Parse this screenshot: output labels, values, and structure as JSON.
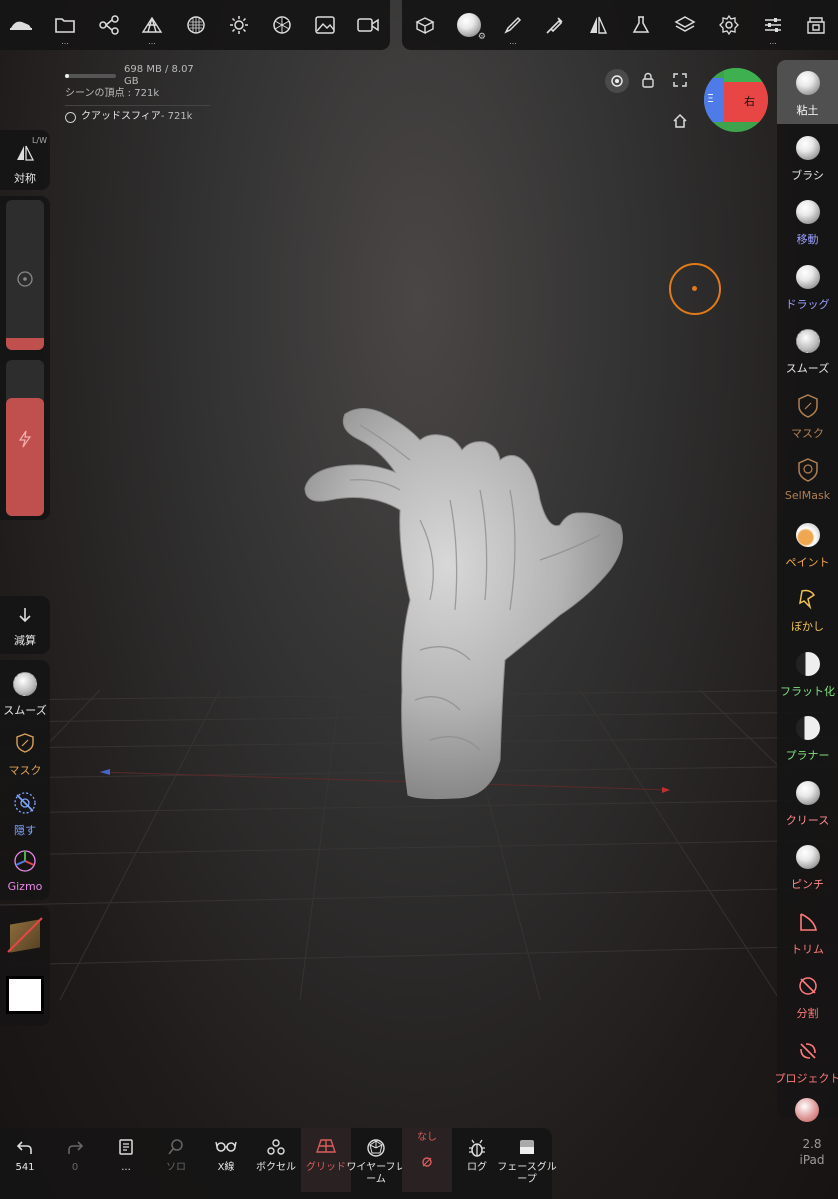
{
  "top_toolbar": {
    "left_icons": [
      "scene-logo-icon",
      "folder-icon",
      "scene-graph-icon",
      "topology-icon",
      "voxel-icon",
      "light-icon",
      "material-icon",
      "image-icon",
      "video-icon"
    ],
    "right_icons": [
      "projection-icon",
      "matcap-sphere-icon",
      "brush-icon",
      "stroke-icon",
      "symmetry-icon",
      "flask-icon",
      "layers-icon",
      "settings-icon",
      "sliders-icon",
      "store-icon"
    ]
  },
  "stats": {
    "memory": "698 MB / 8.07 GB",
    "scene_vertices": "シーンの頂点 : 721k",
    "mesh_name": "クアッドスフィア",
    "mesh_count": " - 721k"
  },
  "gizmo_cube": {
    "right_label": "右",
    "left_label": "Ξ"
  },
  "left_panel": {
    "symmetry_label": "対称",
    "symmetry_badge": "L/W",
    "subtract_label": "減算",
    "tools": [
      {
        "label": "スムーズ",
        "color": "#e6e6e6"
      },
      {
        "label": "マスク",
        "color": "#d9a05b"
      },
      {
        "label": "隠す",
        "color": "#7ea6ff"
      },
      {
        "label": "Gizmo",
        "color": "#e889e8"
      }
    ]
  },
  "right_tools": [
    {
      "label": "粘土",
      "color": "#ffffff",
      "icon": "clay-icon"
    },
    {
      "label": "ブラシ",
      "color": "#e6e6e6",
      "icon": "brush-sphere-icon"
    },
    {
      "label": "移動",
      "color": "#9aa0ff",
      "icon": "move-icon"
    },
    {
      "label": "ドラッグ",
      "color": "#9aa0ff",
      "icon": "drag-icon"
    },
    {
      "label": "スムーズ",
      "color": "#e6e6e6",
      "icon": "smooth-icon"
    },
    {
      "label": "マスク",
      "color": "#b07f52",
      "icon": "mask-icon"
    },
    {
      "label": "SelMask",
      "color": "#b07f52",
      "icon": "selmask-icon"
    },
    {
      "label": "ペイント",
      "color": "#f0a850",
      "icon": "paint-icon"
    },
    {
      "label": "ぼかし",
      "color": "#f0c050",
      "icon": "smudge-icon"
    },
    {
      "label": "フラット化",
      "color": "#7fe07f",
      "icon": "flatten-icon"
    },
    {
      "label": "プラナー",
      "color": "#7fe07f",
      "icon": "planar-icon"
    },
    {
      "label": "クリース",
      "color": "#ff8a8a",
      "icon": "crease-icon"
    },
    {
      "label": "ピンチ",
      "color": "#ff8a8a",
      "icon": "pinch-icon"
    },
    {
      "label": "トリム",
      "color": "#ff7a7a",
      "icon": "trim-icon"
    },
    {
      "label": "分割",
      "color": "#ff7a7a",
      "icon": "split-icon"
    },
    {
      "label": "プロジェクト",
      "color": "#ff7a7a",
      "icon": "project-icon"
    }
  ],
  "bottom_toolbar": [
    {
      "label": "541",
      "icon": "undo-icon",
      "dim": false
    },
    {
      "label": "0",
      "icon": "redo-icon",
      "dim": true
    },
    {
      "label": "...",
      "icon": "notes-icon",
      "dim": false
    },
    {
      "label": "ソロ",
      "icon": "solo-search-icon",
      "dim": true
    },
    {
      "label": "X線",
      "icon": "xray-icon",
      "dim": false
    },
    {
      "label": "ボクセル",
      "icon": "voxel-bottom-icon",
      "dim": false
    },
    {
      "label": "グリッド",
      "icon": "grid-icon",
      "dim": false,
      "active": true
    },
    {
      "label": "ワイヤーフレーム",
      "icon": "wireframe-icon",
      "dim": false
    },
    {
      "label": "なし",
      "icon": "none-icon",
      "dim": false,
      "active": true
    },
    {
      "label": "ログ",
      "icon": "bug-icon",
      "dim": false
    },
    {
      "label": "フェースグループ",
      "icon": "facegroup-icon",
      "dim": false
    }
  ],
  "version": {
    "number": "2.8",
    "device": "iPad"
  },
  "colors": {
    "accent_red": "#c0504d",
    "orange_ring": "#e07a1a"
  }
}
